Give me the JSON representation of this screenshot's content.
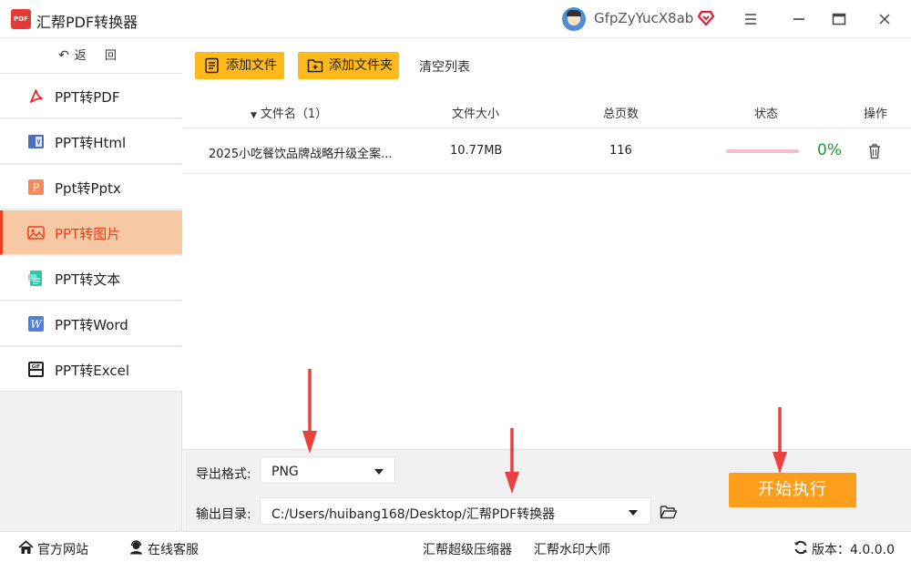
{
  "app": {
    "title": "汇帮PDF转换器",
    "logo_text": "PDF",
    "username": "GfpZyYucX8ab"
  },
  "sidebar": {
    "back_label": "返 回",
    "items": [
      {
        "label": "PPT转PDF",
        "icon": "pdf-icon",
        "active": false
      },
      {
        "label": "PPT转Html",
        "icon": "html-icon",
        "active": false
      },
      {
        "label": "Ppt转Pptx",
        "icon": "pptx-icon",
        "active": false
      },
      {
        "label": "PPT转图片",
        "icon": "image-icon",
        "active": true
      },
      {
        "label": "PPT转文本",
        "icon": "text-icon",
        "active": false
      },
      {
        "label": "PPT转Word",
        "icon": "word-icon",
        "active": false
      },
      {
        "label": "PPT转Excel",
        "icon": "excel-icon",
        "active": false
      }
    ]
  },
  "toolbar": {
    "add_file": "添加文件",
    "add_folder": "添加文件夹",
    "clear_list": "清空列表"
  },
  "table": {
    "headers": {
      "name": "文件名（1）",
      "size": "文件大小",
      "pages": "总页数",
      "status": "状态",
      "ops": "操作"
    },
    "rows": [
      {
        "name": "2025小吃餐饮品牌战略升级全案...",
        "size": "10.77MB",
        "pages": "116",
        "progress": 0,
        "percent": "0%"
      }
    ]
  },
  "settings": {
    "format_label": "导出格式:",
    "format_value": "PNG",
    "dir_label": "输出目录:",
    "dir_value": "C:/Users/huibang168/Desktop/汇帮PDF转换器",
    "start_label": "开始执行"
  },
  "footer": {
    "official_site": "官方网站",
    "online_service": "在线客服",
    "compressor": "汇帮超级压缩器",
    "watermark": "汇帮水印大师",
    "version": "版本：4.0.0.0"
  },
  "colors": {
    "accent": "#ffb91a",
    "start": "#ff9d1c",
    "active_bg": "#f6c8a3",
    "active_text": "#e8411e",
    "progress": "#1a9a3a",
    "arrow": "#e8413e"
  }
}
